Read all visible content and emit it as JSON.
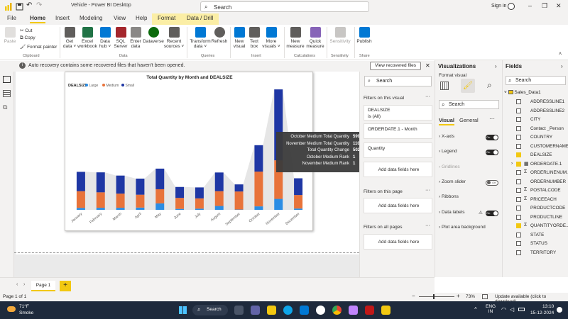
{
  "window": {
    "title": "Vehicle - Power BI Desktop",
    "search_placeholder": "Search",
    "signin": "Sign in"
  },
  "tabs": [
    "File",
    "Home",
    "Insert",
    "Modeling",
    "View",
    "Help",
    "Format",
    "Data / Drill"
  ],
  "ribbon": {
    "clipboard": {
      "paste": "Paste",
      "cut": "Cut",
      "copy": "Copy",
      "format_painter": "Format painter",
      "group": "Clipboard"
    },
    "data": {
      "buttons": [
        {
          "l1": "Get",
          "l2": "data ˅"
        },
        {
          "l1": "Excel",
          "l2": "workbook"
        },
        {
          "l1": "Data",
          "l2": "hub ˅"
        },
        {
          "l1": "SQL",
          "l2": "Server"
        },
        {
          "l1": "Enter",
          "l2": "data"
        },
        {
          "l1": "Dataverse",
          "l2": ""
        },
        {
          "l1": "Recent",
          "l2": "sources ˅"
        }
      ],
      "group": "Data"
    },
    "queries": {
      "buttons": [
        {
          "l1": "Transform",
          "l2": "data ˅"
        },
        {
          "l1": "Refresh",
          "l2": ""
        }
      ],
      "group": "Queries"
    },
    "insert": {
      "buttons": [
        {
          "l1": "New",
          "l2": "visual"
        },
        {
          "l1": "Text",
          "l2": "box"
        },
        {
          "l1": "More",
          "l2": "visuals ˅"
        }
      ],
      "group": "Insert"
    },
    "calculations": {
      "buttons": [
        {
          "l1": "New",
          "l2": "measure"
        },
        {
          "l1": "Quick",
          "l2": "measure"
        }
      ],
      "group": "Calculations"
    },
    "sensitivity": {
      "buttons": [
        {
          "l1": "Sensitivity",
          "l2": ""
        }
      ],
      "group": "Sensitivity"
    },
    "share": {
      "buttons": [
        {
          "l1": "Publish",
          "l2": ""
        }
      ],
      "group": "Share"
    }
  },
  "infobar": {
    "message": "Auto recovery contains some recovered files that haven't been opened.",
    "button": "View recovered files"
  },
  "chart_data": {
    "type": "bar",
    "title": "Total Quantity by Month and DEALSIZE",
    "legend_title": "DEALSIZE",
    "legend_position": "top-left",
    "categories": [
      "January",
      "February",
      "March",
      "April",
      "May",
      "June",
      "July",
      "August",
      "September",
      "October",
      "November",
      "December"
    ],
    "series": [
      {
        "name": "Large",
        "color": "#2b8de4",
        "values": [
          300,
          320,
          320,
          350,
          1000,
          150,
          180,
          600,
          50,
          540,
          1700,
          200
        ]
      },
      {
        "name": "Medium",
        "color": "#e8733a",
        "values": [
          2600,
          2400,
          2200,
          2000,
          2200,
          1700,
          1600,
          2300,
          2800,
          5400,
          5992,
          2100
        ]
      },
      {
        "name": "Small",
        "color": "#1f37a4",
        "values": [
          3000,
          3100,
          2800,
          2500,
          3200,
          1700,
          1700,
          2900,
          1100,
          4100,
          11015,
          2600
        ]
      }
    ],
    "ylim": [
      0,
      18500
    ],
    "grid": false
  },
  "tooltip": [
    {
      "k": "October Medium Total Quantity",
      "v": "5992"
    },
    {
      "k": "November Medium Total Quantity",
      "v": "11015"
    },
    {
      "k": "Total Quantity Change",
      "v": "5023 (83.83%)"
    },
    {
      "k": "October Medium Rank",
      "v": "1"
    },
    {
      "k": "November Medium Rank",
      "v": "1"
    }
  ],
  "filters": {
    "search": "Search",
    "on_visual": "Filters on this visual",
    "card1_title": "DEALSIZE",
    "card1_value": "is (All)",
    "card2_title": "ORDERDATE.1 - Month",
    "card3_title": "Quantity",
    "add_fields": "Add data fields here",
    "on_page": "Filters on this page",
    "on_all": "Filters on all pages"
  },
  "viz": {
    "title": "Visualizations",
    "subtitle": "Format visual",
    "search": "Search",
    "tab_visual": "Visual",
    "tab_general": "General",
    "rows": [
      {
        "label": "X-axis",
        "toggle": "On"
      },
      {
        "label": "Legend",
        "toggle": "On"
      },
      {
        "label": "Gridlines",
        "toggle": ""
      },
      {
        "label": "Zoom slider",
        "toggle": "Off"
      },
      {
        "label": "Ribbons",
        "toggle": ""
      },
      {
        "label": "Data labels",
        "toggle": "On"
      },
      {
        "label": "Plot area background",
        "toggle": ""
      }
    ]
  },
  "fields": {
    "title": "Fields",
    "search": "Search",
    "table": "Sales_Data1",
    "items": [
      {
        "name": "ADDRESSLINE1",
        "checked": false,
        "sigma": false
      },
      {
        "name": "ADDRESSLINE2",
        "checked": false,
        "sigma": false
      },
      {
        "name": "CITY",
        "checked": false,
        "sigma": false
      },
      {
        "name": "Contact _Person",
        "checked": false,
        "sigma": false
      },
      {
        "name": "COUNTRY",
        "checked": false,
        "sigma": false
      },
      {
        "name": "CUSTOMERNAME",
        "checked": false,
        "sigma": false
      },
      {
        "name": "DEALSIZE",
        "checked": true,
        "sigma": false
      },
      {
        "name": "ORDERDATE.1",
        "checked": true,
        "sigma": false
      },
      {
        "name": "ORDERLINENUM...",
        "checked": false,
        "sigma": true
      },
      {
        "name": "ORDERNUMBER",
        "checked": false,
        "sigma": false
      },
      {
        "name": "POSTALCODE",
        "checked": false,
        "sigma": true
      },
      {
        "name": "PRICEEACH",
        "checked": false,
        "sigma": true
      },
      {
        "name": "PRODUCTCODE",
        "checked": false,
        "sigma": false
      },
      {
        "name": "PRODUCTLINE",
        "checked": false,
        "sigma": false
      },
      {
        "name": "QUANTITYORDE...",
        "checked": true,
        "sigma": true
      },
      {
        "name": "STATE",
        "checked": false,
        "sigma": false
      },
      {
        "name": "STATUS",
        "checked": false,
        "sigma": false
      },
      {
        "name": "TERRITORY",
        "checked": false,
        "sigma": false
      }
    ]
  },
  "pages": {
    "tab": "Page 1",
    "add": "+"
  },
  "status": {
    "page": "Page 1 of 1",
    "zoom": "73%",
    "update": "Update available (click to download)"
  },
  "taskbar": {
    "weather_temp": "71°F",
    "weather_desc": "Smoke",
    "search": "Search",
    "lang1": "ENG",
    "lang2": "IN",
    "time": "13:10",
    "date": "15-12-2024"
  }
}
